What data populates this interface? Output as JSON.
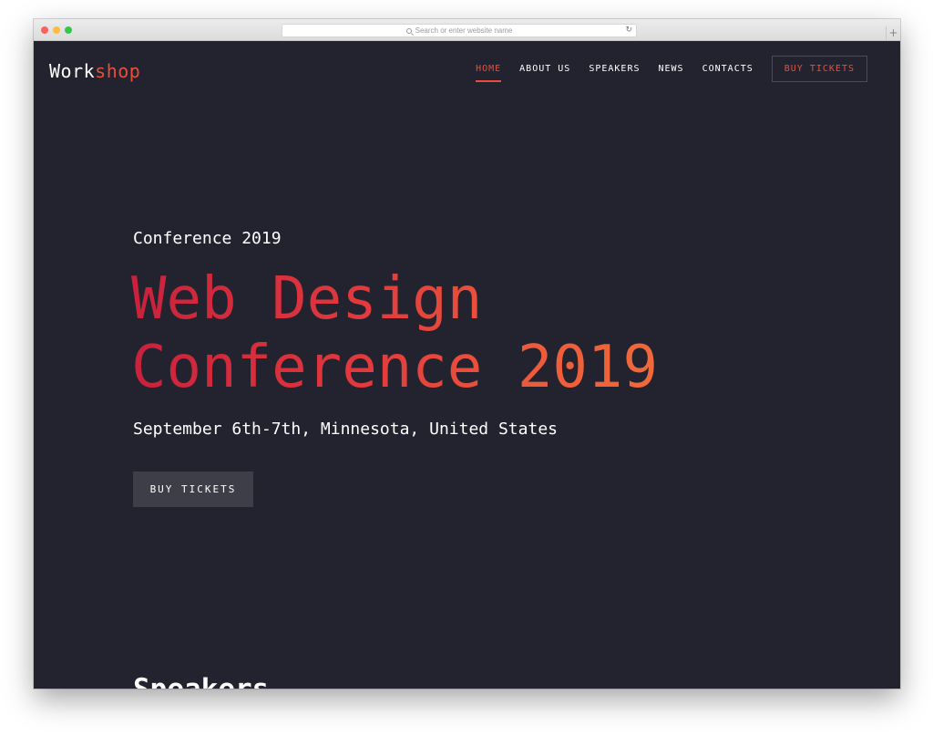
{
  "browser": {
    "url_placeholder": "Search or enter website name",
    "reload_icon": "reload-icon",
    "new_tab_icon": "plus-icon",
    "new_tab_glyph": "+"
  },
  "site": {
    "logo_part1": "Work",
    "logo_part2": "shop",
    "accent_color": "#e94e3c",
    "background_color": "#22232f"
  },
  "nav": {
    "items": [
      {
        "label": "HOME",
        "active": true
      },
      {
        "label": "ABOUT US",
        "active": false
      },
      {
        "label": "SPEAKERS",
        "active": false
      },
      {
        "label": "NEWS",
        "active": false
      },
      {
        "label": "CONTACTS",
        "active": false
      }
    ],
    "button_label": "BUY TICKETS"
  },
  "hero": {
    "eyebrow": "Conference 2019",
    "headline_line1": "Web Design",
    "headline_line2": "Conference 2019",
    "subhead": "September 6th-7th, Minnesota, United States",
    "cta_label": "BUY TICKETS"
  },
  "speakers": {
    "title": "Speakers"
  }
}
